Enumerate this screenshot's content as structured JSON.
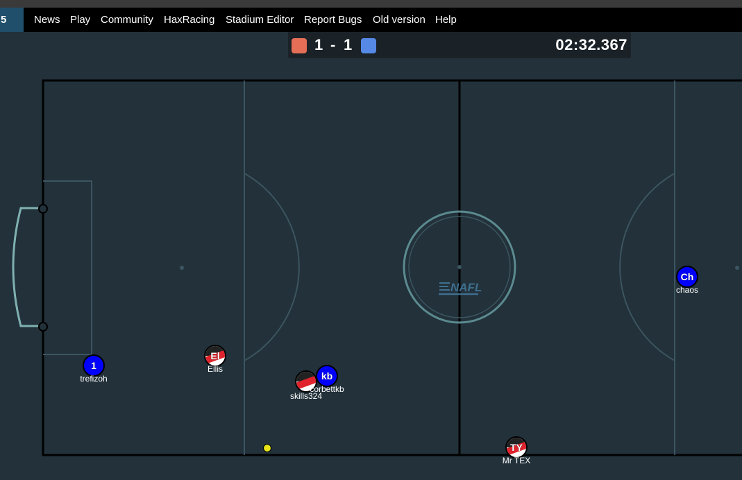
{
  "navbar": {
    "badge": "5",
    "items": [
      "News",
      "Play",
      "Community",
      "HaxRacing",
      "Stadium Editor",
      "Report Bugs",
      "Old version",
      "Help"
    ]
  },
  "scoreboard": {
    "red_score": "1",
    "separator": "-",
    "blue_score": "1",
    "time": "02:32.367",
    "red_color": "#e56e56",
    "blue_color": "#5689e5"
  },
  "field": {
    "logo_text": "NAFL",
    "background": "#22313a",
    "line_color": "#3c5560"
  },
  "players": [
    {
      "name": "trefizoh",
      "avatar": "1",
      "team": "blue"
    },
    {
      "name": "Ellis",
      "avatar": "El",
      "team": "red"
    },
    {
      "name": "skills324",
      "avatar": "",
      "team": "red"
    },
    {
      "name": "corbettkb",
      "avatar": "kb",
      "team": "blue"
    },
    {
      "name": "chaos",
      "avatar": "Ch",
      "team": "blue"
    },
    {
      "name": "Mr TEX",
      "avatar": "TY",
      "team": "red"
    }
  ],
  "ball": {
    "color": "#e8e419"
  }
}
